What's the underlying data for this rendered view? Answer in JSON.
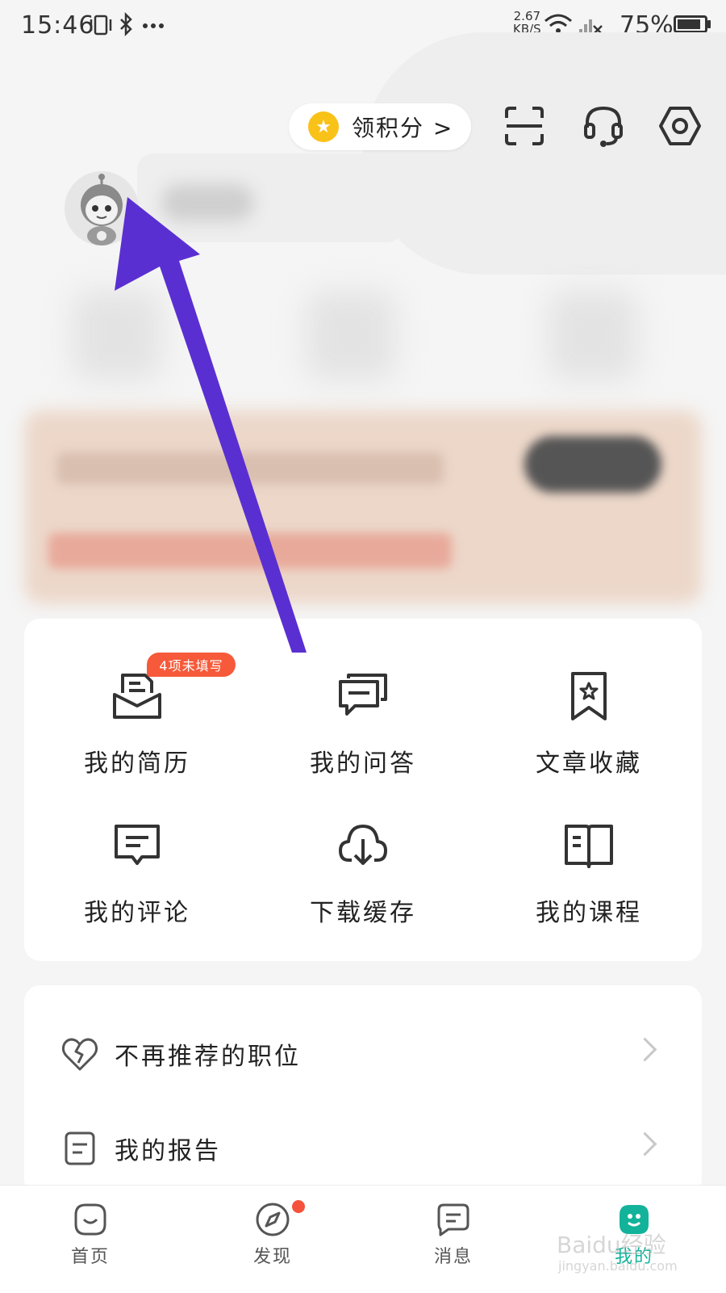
{
  "status_bar": {
    "time": "15:46",
    "net_speed": "2.67",
    "net_unit": "KB/S",
    "battery": "75%"
  },
  "header": {
    "points_label": "领积分 >"
  },
  "grid": [
    {
      "label": "我的简历",
      "icon": "resume-icon",
      "badge": "4项未填写"
    },
    {
      "label": "我的问答",
      "icon": "qa-icon"
    },
    {
      "label": "文章收藏",
      "icon": "bookmark-star-icon"
    },
    {
      "label": "我的评论",
      "icon": "comment-icon"
    },
    {
      "label": "下载缓存",
      "icon": "cloud-download-icon"
    },
    {
      "label": "我的课程",
      "icon": "book-icon"
    }
  ],
  "list": [
    {
      "label": "不再推荐的职位",
      "icon": "broken-heart-icon"
    },
    {
      "label": "我的报告",
      "icon": "report-icon"
    }
  ],
  "tabbar": [
    {
      "label": "首页",
      "icon": "home-icon"
    },
    {
      "label": "发现",
      "icon": "compass-icon"
    },
    {
      "label": "消息",
      "icon": "message-icon"
    },
    {
      "label": "我的",
      "icon": "profile-icon"
    }
  ],
  "colors": {
    "accent": "#12b39a",
    "badge": "#f65a3a",
    "arrow": "#5a2fd1"
  },
  "watermark": {
    "text": "Baidu经验",
    "sub": "jingyan.baidu.com"
  }
}
